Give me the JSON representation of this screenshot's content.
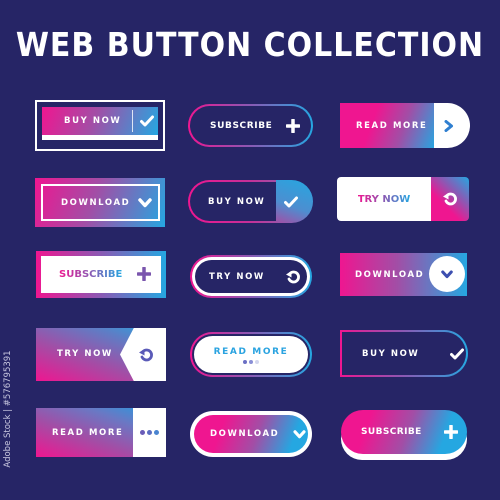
{
  "title": "WEB BUTTON COLLECTION",
  "stock_id": "Adobe Stock | #576795391",
  "colors": {
    "background": "#262566",
    "pink": "#ef1690",
    "purple": "#8a5ab4",
    "blue": "#25a7e1",
    "white": "#ffffff"
  },
  "buttons": [
    {
      "label": "BUY NOW",
      "icon": "check-icon"
    },
    {
      "label": "SUBSCRIBE",
      "icon": "plus-icon"
    },
    {
      "label": "READ MORE",
      "icon": "chevron-right-icon"
    },
    {
      "label": "DOWNLOAD",
      "icon": "chevron-down-icon"
    },
    {
      "label": "BUY NOW",
      "icon": "check-icon"
    },
    {
      "label": "TRY NOW",
      "icon": "refresh-icon"
    },
    {
      "label": "SUBSCRIBE",
      "icon": "plus-icon"
    },
    {
      "label": "TRY NOW",
      "icon": "refresh-icon"
    },
    {
      "label": "DOWNLOAD",
      "icon": "chevron-down-icon"
    },
    {
      "label": "TRY NOW",
      "icon": "refresh-icon"
    },
    {
      "label": "READ MORE",
      "icon": "dots-icon"
    },
    {
      "label": "BUY NOW",
      "icon": "check-icon"
    },
    {
      "label": "READ MORE",
      "icon": "more-dots-icon"
    },
    {
      "label": "DOWNLOAD",
      "icon": "chevron-down-icon"
    },
    {
      "label": "SUBSCRIBE",
      "icon": "plus-icon"
    }
  ]
}
